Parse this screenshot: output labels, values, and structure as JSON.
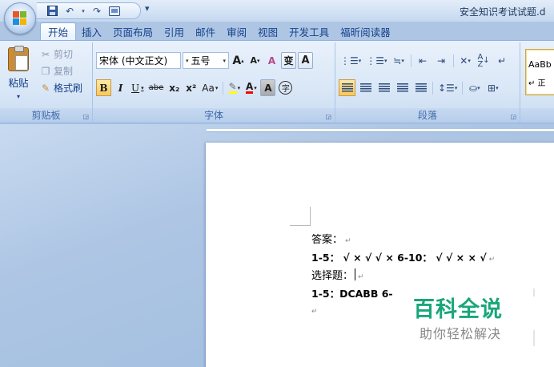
{
  "window": {
    "title": "安全知识考试试题.d"
  },
  "quick_access": {
    "save_icon": "save-icon",
    "undo_icon": "undo-icon",
    "redo_icon": "redo-icon",
    "customize_icon": "chevron-down-icon"
  },
  "tabs": [
    {
      "label": "开始",
      "active": true
    },
    {
      "label": "插入"
    },
    {
      "label": "页面布局"
    },
    {
      "label": "引用"
    },
    {
      "label": "邮件"
    },
    {
      "label": "审阅"
    },
    {
      "label": "视图"
    },
    {
      "label": "开发工具"
    },
    {
      "label": "福昕阅读器"
    }
  ],
  "clipboard": {
    "group_label": "剪贴板",
    "paste": "粘贴",
    "cut": "剪切",
    "copy": "复制",
    "format_painter": "格式刷"
  },
  "font": {
    "group_label": "字体",
    "font_name": "宋体 (中文正文)",
    "font_size": "五号",
    "grow": "A",
    "shrink": "A",
    "clear": "A",
    "phonetic": "变",
    "char_border": "A",
    "bold": "B",
    "italic": "I",
    "underline": "U",
    "strike": "abe",
    "subscript": "x₂",
    "superscript": "x²",
    "change_case": "Aa",
    "char_shading": "A",
    "enclose": "字"
  },
  "paragraph": {
    "group_label": "段落"
  },
  "styles": {
    "preview": "AaBb",
    "sub": "↵ 正"
  },
  "colors": {
    "accent": "#15428b",
    "highlight": "#ffff00",
    "font_color": "#ff0000",
    "watermark": "#19a67a"
  },
  "document": {
    "lines": [
      {
        "text": "答案：",
        "mark": "↵"
      },
      {
        "text": "1-5： √ × √ √ ×    6-10： √ √ × × √",
        "mark": "↵"
      },
      {
        "text": "选择题：",
        "mark": "↵"
      },
      {
        "text": "1-5：DCABB   6-",
        "mark": ""
      },
      {
        "text": "",
        "mark": "↵"
      }
    ]
  },
  "watermark": {
    "title": "百科全说",
    "subtitle": "助你轻松解决"
  }
}
